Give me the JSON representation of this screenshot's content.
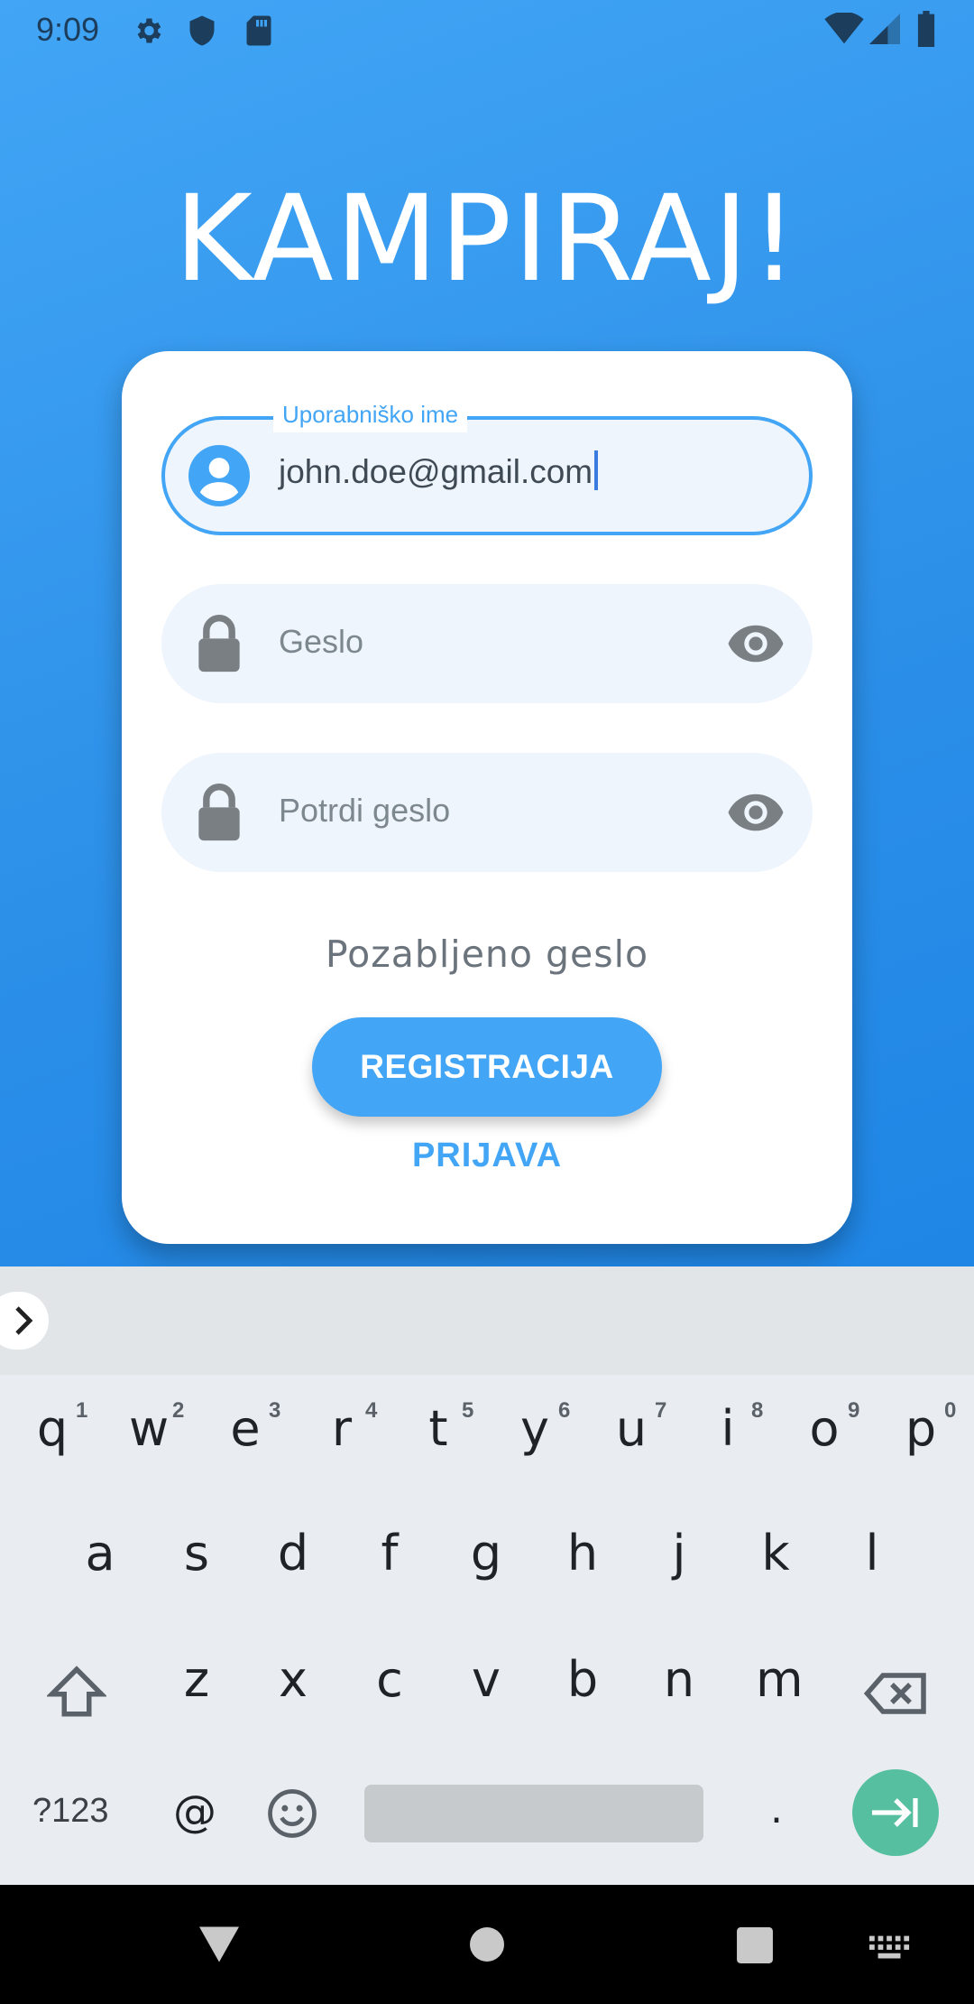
{
  "status_bar": {
    "time": "9:09",
    "left_icons": [
      "gear-icon",
      "shield-icon",
      "sd-card-icon"
    ],
    "right_icons": [
      "wifi-icon",
      "signal-icon",
      "battery-icon"
    ]
  },
  "app": {
    "title": "KAMPIRAJ!",
    "colors": {
      "accent": "#42a5f5",
      "card": "#ffffff",
      "field_bg": "#eef5fc"
    }
  },
  "form": {
    "username": {
      "label": "Uporabniško ime",
      "value": "john.doe@gmail.com",
      "icon": "account-circle-icon"
    },
    "password": {
      "placeholder": "Geslo",
      "icon": "lock-icon",
      "toggle_icon": "eye-icon"
    },
    "confirm_password": {
      "placeholder": "Potrdi geslo",
      "icon": "lock-icon",
      "toggle_icon": "eye-icon"
    },
    "forgot_password": "Pozabljeno geslo",
    "register_button": "REGISTRACIJA",
    "login_link": "PRIJAVA"
  },
  "keyboard": {
    "row1": [
      {
        "k": "q",
        "h": "1"
      },
      {
        "k": "w",
        "h": "2"
      },
      {
        "k": "e",
        "h": "3"
      },
      {
        "k": "r",
        "h": "4"
      },
      {
        "k": "t",
        "h": "5"
      },
      {
        "k": "y",
        "h": "6"
      },
      {
        "k": "u",
        "h": "7"
      },
      {
        "k": "i",
        "h": "8"
      },
      {
        "k": "o",
        "h": "9"
      },
      {
        "k": "p",
        "h": "0"
      }
    ],
    "row2": [
      "a",
      "s",
      "d",
      "f",
      "g",
      "h",
      "j",
      "k",
      "l"
    ],
    "row3": [
      "z",
      "x",
      "c",
      "v",
      "b",
      "n",
      "m"
    ],
    "symbols_key": "?123",
    "at_key": "@",
    "period_key": ".",
    "icons": [
      "expand-chevron-icon",
      "shift-icon",
      "backspace-icon",
      "emoji-icon",
      "enter-arrow-icon"
    ]
  },
  "nav_bar": {
    "icons": [
      "back-icon",
      "home-icon",
      "recents-icon",
      "keyboard-switch-icon"
    ]
  }
}
